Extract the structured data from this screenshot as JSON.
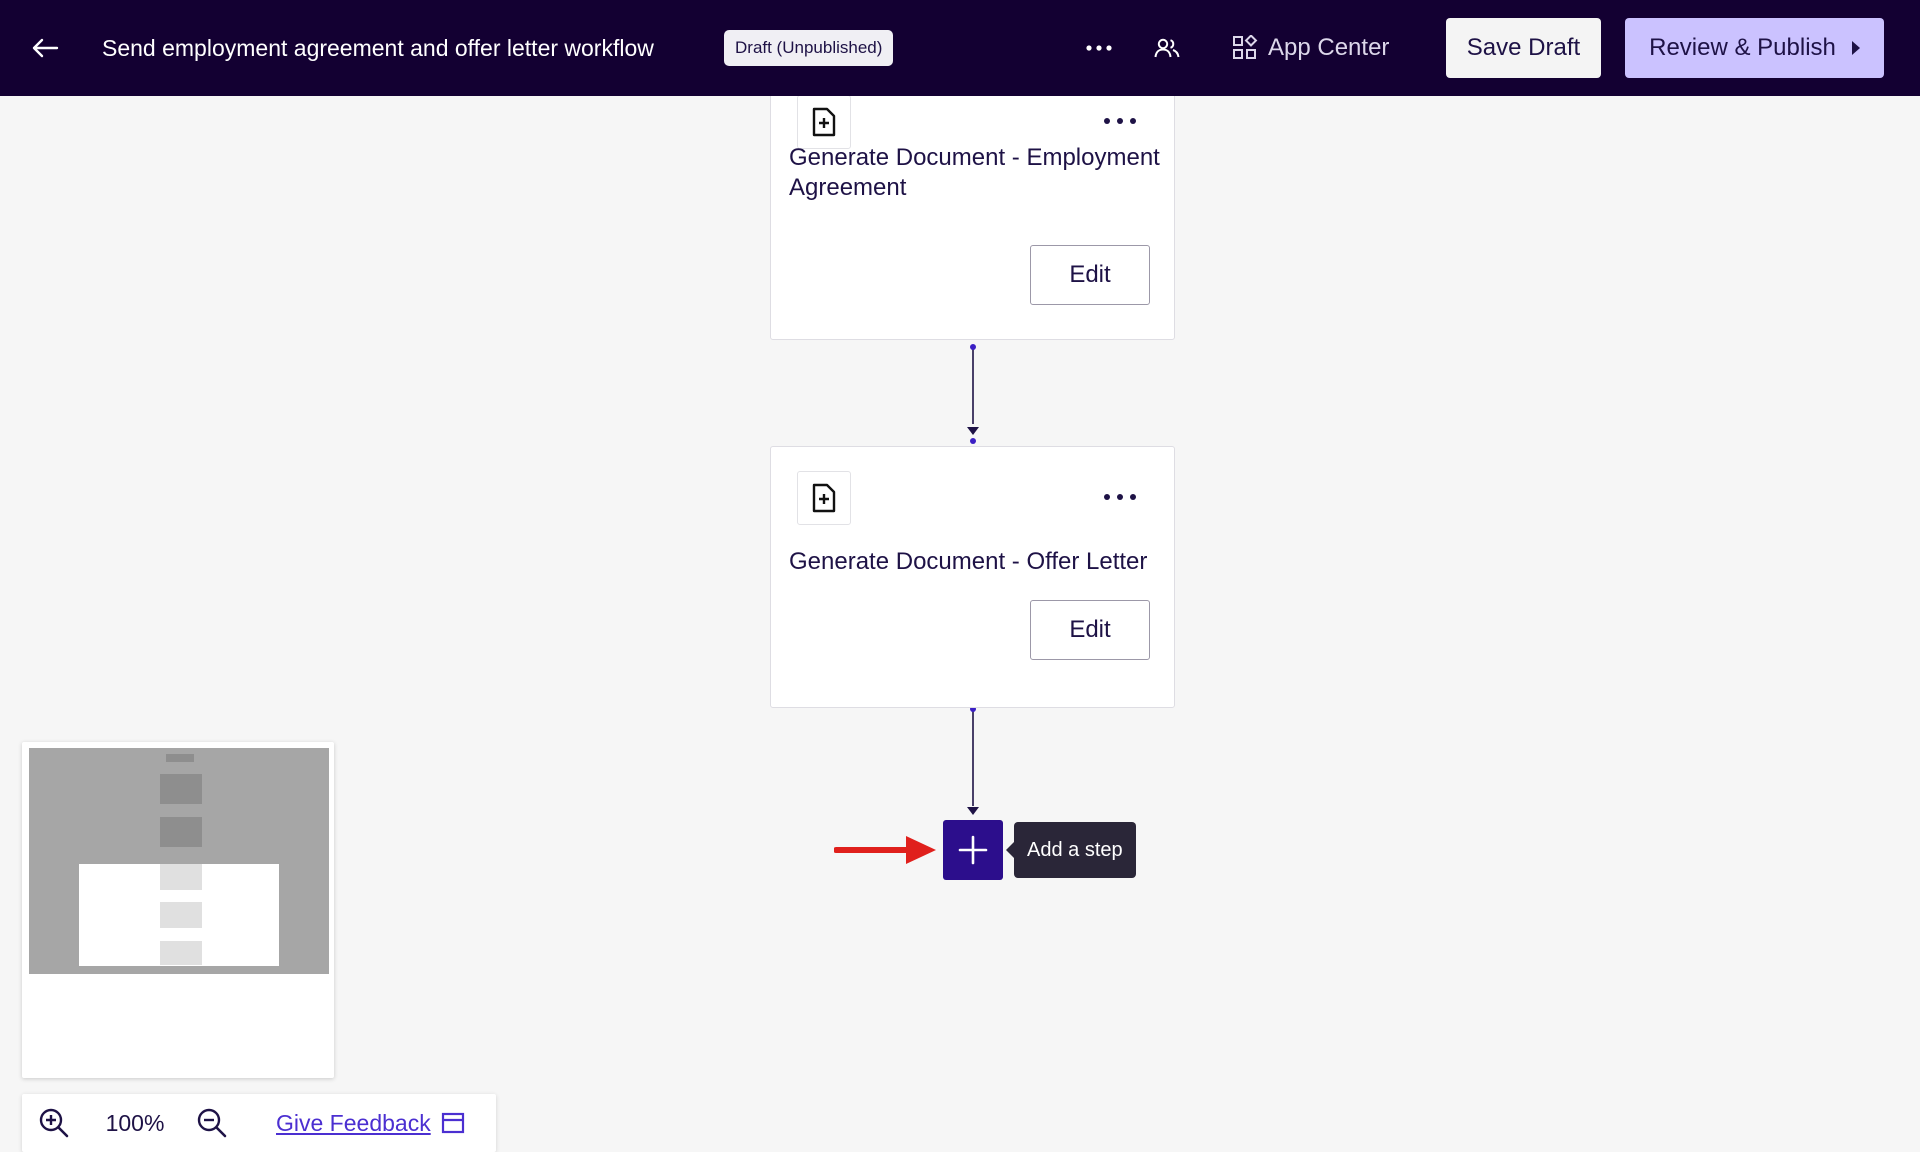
{
  "header": {
    "back_icon": "arrow-left-icon",
    "title": "Send employment agreement and offer letter workflow",
    "status_badge": "Draft (Unpublished)",
    "more_icon": "more-horizontal-icon",
    "collaborators_icon": "people-icon",
    "app_center_icon": "app-grid-icon",
    "app_center_label": "App Center",
    "save_draft_label": "Save Draft",
    "publish_label": "Review & Publish",
    "publish_icon": "caret-right-icon"
  },
  "steps": [
    {
      "icon": "document-add-icon",
      "menu_icon": "more-horizontal-icon",
      "title": "Generate Document - Employment Agreement",
      "edit_label": "Edit"
    },
    {
      "icon": "document-add-icon",
      "menu_icon": "more-horizontal-icon",
      "title": "Generate Document - Offer Letter",
      "edit_label": "Edit"
    }
  ],
  "add_step": {
    "icon": "plus-icon",
    "tooltip": "Add a step"
  },
  "zoom_controls": {
    "zoom_in_icon": "zoom-in-icon",
    "zoom_level": "100%",
    "zoom_out_icon": "zoom-out-icon",
    "feedback_label": "Give Feedback",
    "feedback_icon": "window-icon"
  },
  "colors": {
    "header_bg": "#130032",
    "publish_bg": "#cbc2ff",
    "add_step_bg": "#2c0e8c",
    "annotation_arrow": "#e0201c",
    "link": "#4b2fd1"
  }
}
